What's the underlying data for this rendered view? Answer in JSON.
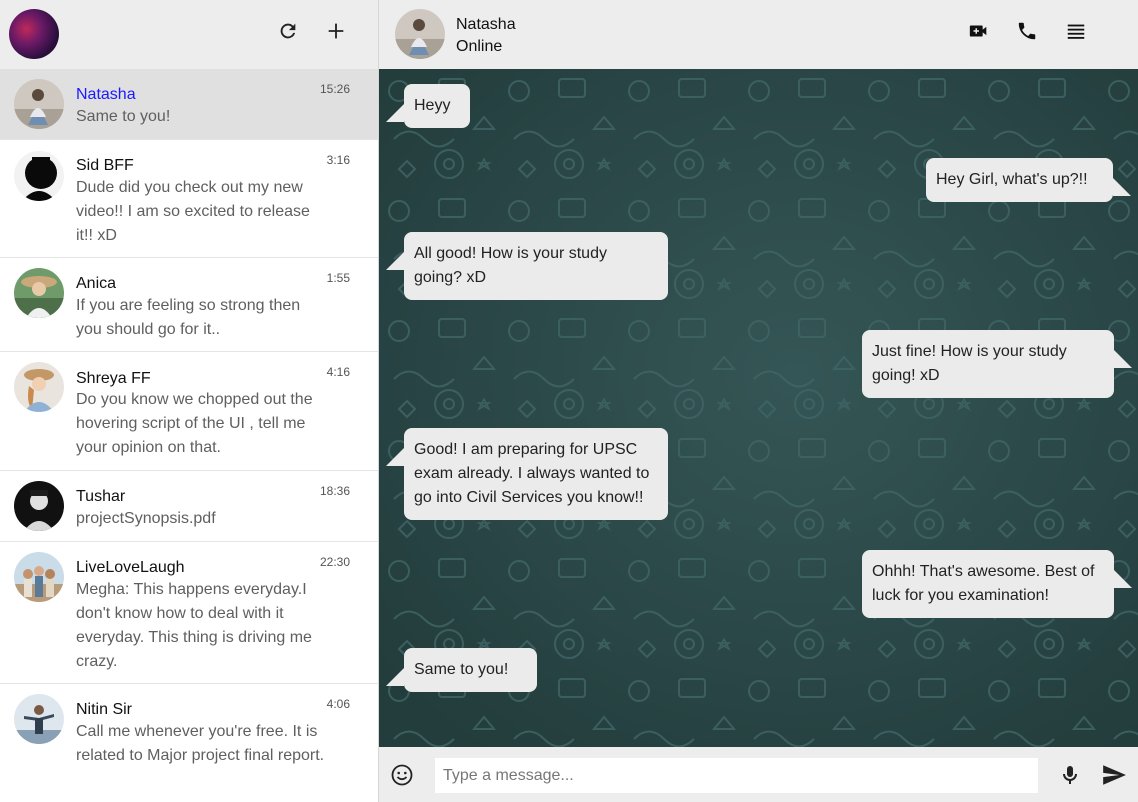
{
  "sidebar": {
    "chats": [
      {
        "name": "Natasha",
        "time": "15:26",
        "message": "Same to you!"
      },
      {
        "name": "Sid BFF",
        "time": "3:16",
        "message": "Dude did you check out my new video!! I am so excited to release it!! xD"
      },
      {
        "name": "Anica",
        "time": "1:55",
        "message": "If you are feeling so strong then you should go for it.."
      },
      {
        "name": "Shreya FF",
        "time": "4:16",
        "message": "Do you know we chopped out the hovering script of the UI , tell me your opinion on that."
      },
      {
        "name": "Tushar",
        "time": "18:36",
        "message": "projectSynopsis.pdf"
      },
      {
        "name": "LiveLoveLaugh",
        "time": "22:30",
        "message": "Megha: This happens everyday.I don't know how to deal with it everyday. This thing is driving me crazy."
      },
      {
        "name": "Nitin Sir",
        "time": "4:06",
        "message": "Call me whenever you're free. It is related to Major project final report."
      }
    ]
  },
  "conversation": {
    "contact_name": "Natasha",
    "status": "Online",
    "messages": [
      {
        "side": "in",
        "text": "Heyy"
      },
      {
        "side": "out",
        "text": "Hey Girl, what's up?!!"
      },
      {
        "side": "in",
        "text": "All good! How is your study going? xD"
      },
      {
        "side": "out",
        "text": "Just fine! How is your study going! xD"
      },
      {
        "side": "in",
        "text": "Good! I am preparing for UPSC exam already. I always wanted to go into Civil Services you know!!"
      },
      {
        "side": "out",
        "text": "Ohhh! That's awesome. Best of luck for you examination!"
      },
      {
        "side": "in",
        "text": "Same to you!"
      }
    ]
  },
  "composer": {
    "placeholder": "Type a message..."
  },
  "icons": {
    "refresh": "refresh-icon",
    "new_chat": "plus-icon",
    "video": "video-call-icon",
    "phone": "phone-icon",
    "menu": "menu-icon",
    "emoji": "emoji-icon",
    "mic": "mic-icon",
    "send": "send-icon"
  },
  "colors": {
    "header_bg": "#ededed",
    "chat_bg": "#2e4a4a",
    "bubble": "#ebebeb",
    "active_name": "#1a1aff"
  }
}
